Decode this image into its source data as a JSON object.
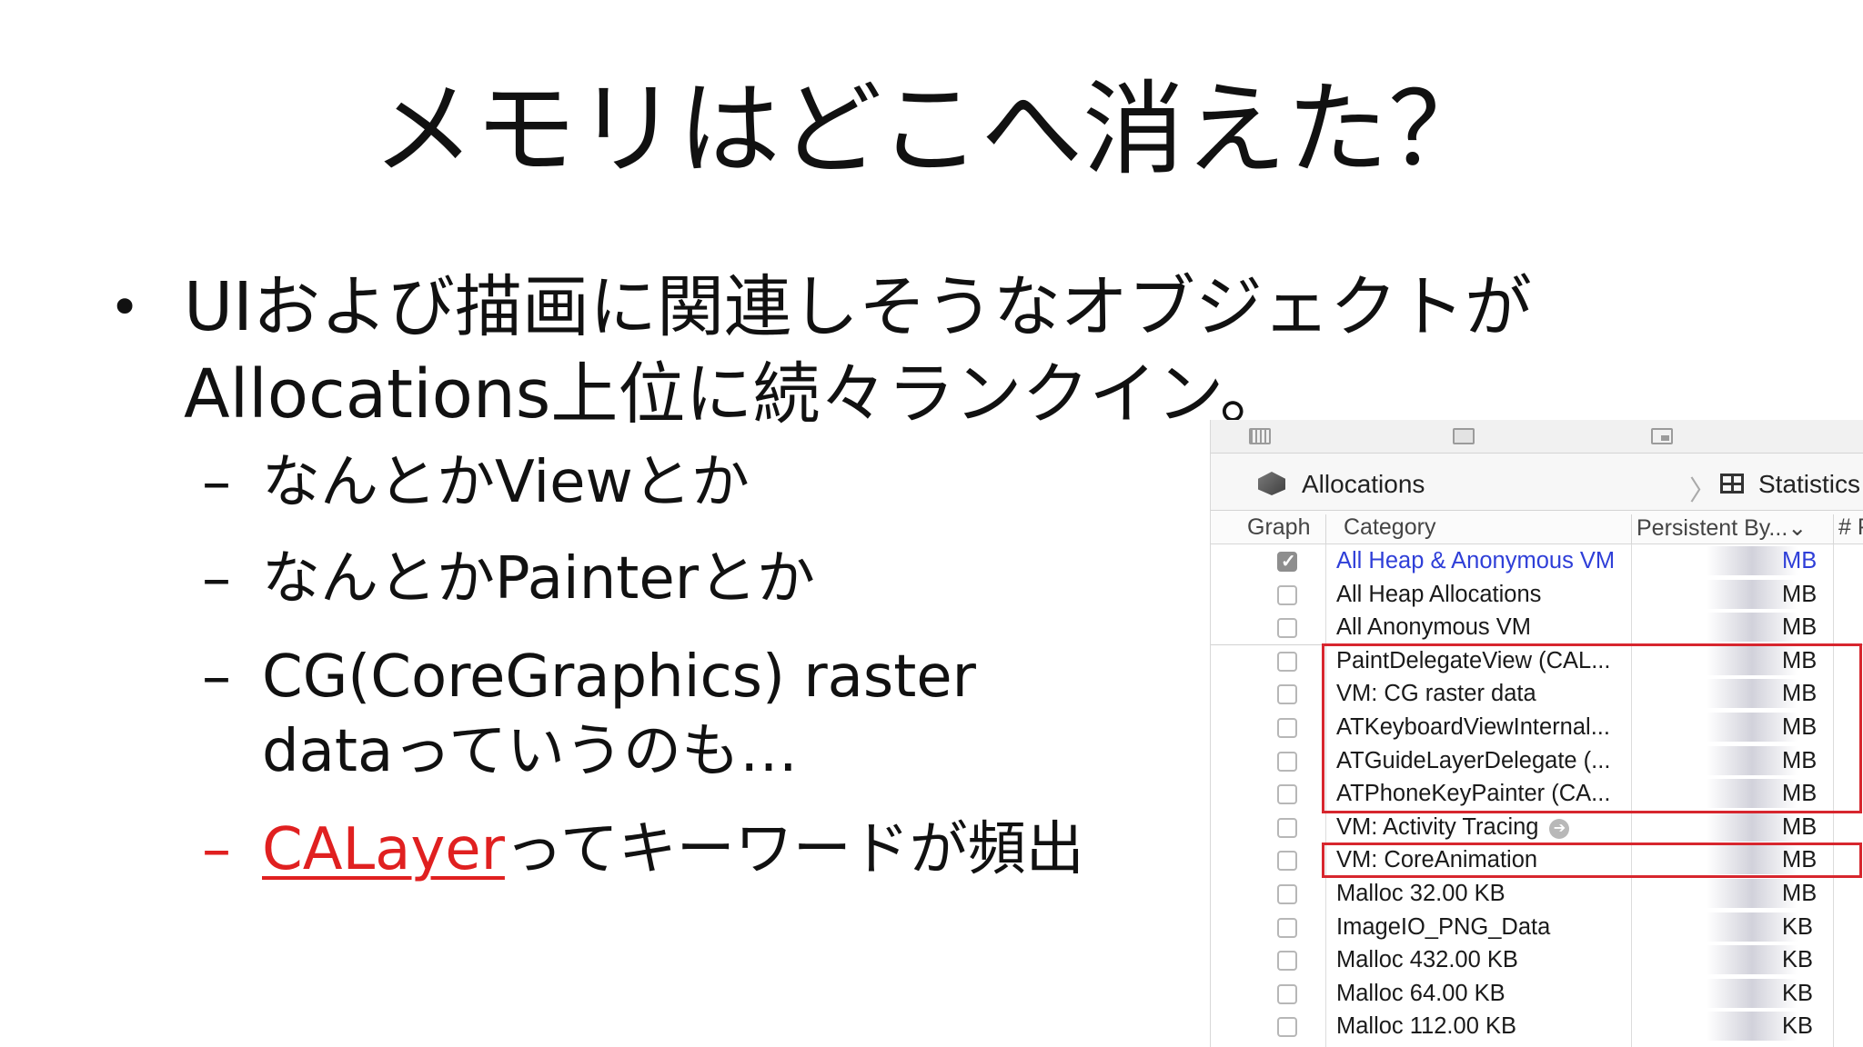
{
  "slide": {
    "title": "メモリはどこへ消えた？",
    "bullet": {
      "marker": "•",
      "line1": "UIおよび描画に関連しそうなオブジェクトが",
      "line2": "Allocations上位に続々ランクイン。"
    },
    "subitems": [
      {
        "dash": "–",
        "text": "なんとかViewとか"
      },
      {
        "dash": "–",
        "text": "なんとかPainterとか"
      },
      {
        "dash": "–",
        "text": "CG(CoreGraphics) raster",
        "text2": "dataっていうのも…"
      }
    ],
    "highlight_item": {
      "dash": "–",
      "link": "CALayer",
      "rest": "ってキーワードが頻出"
    }
  },
  "instruments": {
    "breadcrumb": {
      "instrument": "Allocations",
      "separator": "〉",
      "view": "Statistics"
    },
    "columns": {
      "graph": "Graph",
      "category": "Category",
      "persistent": "Persistent By...⌄",
      "hash": "# P"
    },
    "rows": [
      {
        "category": "All Heap & Anonymous VM",
        "unit": "MB",
        "checked": true,
        "blue": true
      },
      {
        "category": "All Heap Allocations",
        "unit": "MB"
      },
      {
        "category": "All Anonymous VM",
        "unit": "MB"
      },
      {
        "category": "PaintDelegateView (CAL...",
        "unit": "MB"
      },
      {
        "category": "VM: CG raster data",
        "unit": "MB"
      },
      {
        "category": "ATKeyboardViewInternal...",
        "unit": "MB"
      },
      {
        "category": "ATGuideLayerDelegate (...",
        "unit": "MB"
      },
      {
        "category": "ATPhoneKeyPainter (CA...",
        "unit": "MB"
      },
      {
        "category": "VM: Activity Tracing",
        "unit": "MB",
        "go_icon": true
      },
      {
        "category": "VM: CoreAnimation",
        "unit": "MB"
      },
      {
        "category": "Malloc 32.00 KB",
        "unit": "MB"
      },
      {
        "category": "ImageIO_PNG_Data",
        "unit": "KB"
      },
      {
        "category": "Malloc 432.00 KB",
        "unit": "KB"
      },
      {
        "category": "Malloc 64.00 KB",
        "unit": "KB"
      },
      {
        "category": "Malloc 112.00 KB",
        "unit": "KB"
      }
    ]
  },
  "colors": {
    "highlight_red": "#d7262e",
    "link_red": "#e02020",
    "selected_blue": "#2f3fd8"
  }
}
